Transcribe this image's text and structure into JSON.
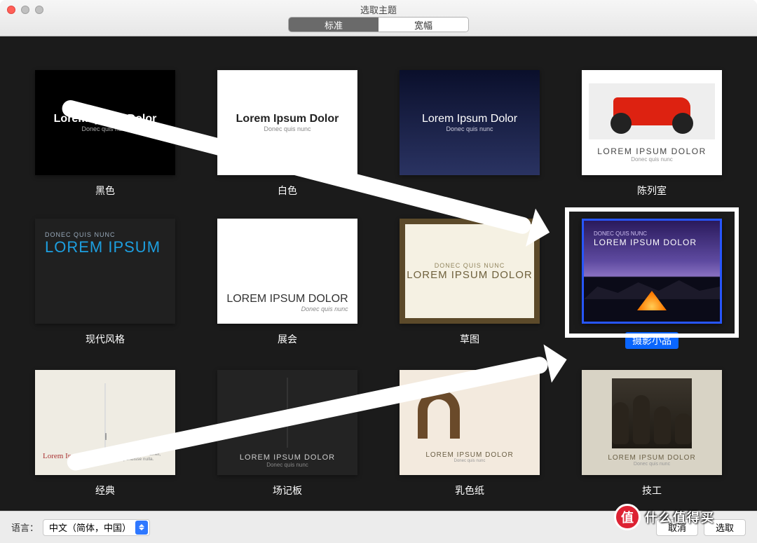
{
  "window": {
    "title": "选取主题"
  },
  "tabs": {
    "standard": "标准",
    "wide": "宽幅"
  },
  "placeholders": {
    "title": "Lorem Ipsum Dolor",
    "sub": "Donec quis nunc",
    "pre": "DONEC QUIS NUNC",
    "title_upper": "LOREM IPSUM DOLOR",
    "title_short": "LOREM IPSUM",
    "desc_small": "Lorem ipsum dolor sit amet, ligula suspendisse nulla."
  },
  "themes": [
    {
      "key": "black",
      "label": "黑色"
    },
    {
      "key": "white",
      "label": "白色"
    },
    {
      "key": "gradient",
      "label": ""
    },
    {
      "key": "showroom",
      "label": "陈列室"
    },
    {
      "key": "modern",
      "label": "现代风格"
    },
    {
      "key": "exhibit",
      "label": "展会"
    },
    {
      "key": "sketch",
      "label": "草图"
    },
    {
      "key": "photo",
      "label": "摄影小品",
      "selected": true
    },
    {
      "key": "classic",
      "label": "经典"
    },
    {
      "key": "board",
      "label": "场记板"
    },
    {
      "key": "cream",
      "label": "乳色纸"
    },
    {
      "key": "craft",
      "label": "技工"
    }
  ],
  "footer": {
    "language_label": "语言：",
    "language_value": "中文（简体，中国）",
    "cancel": "取消",
    "choose": "选取"
  },
  "badge": {
    "char": "值",
    "text": "什么值得买"
  }
}
